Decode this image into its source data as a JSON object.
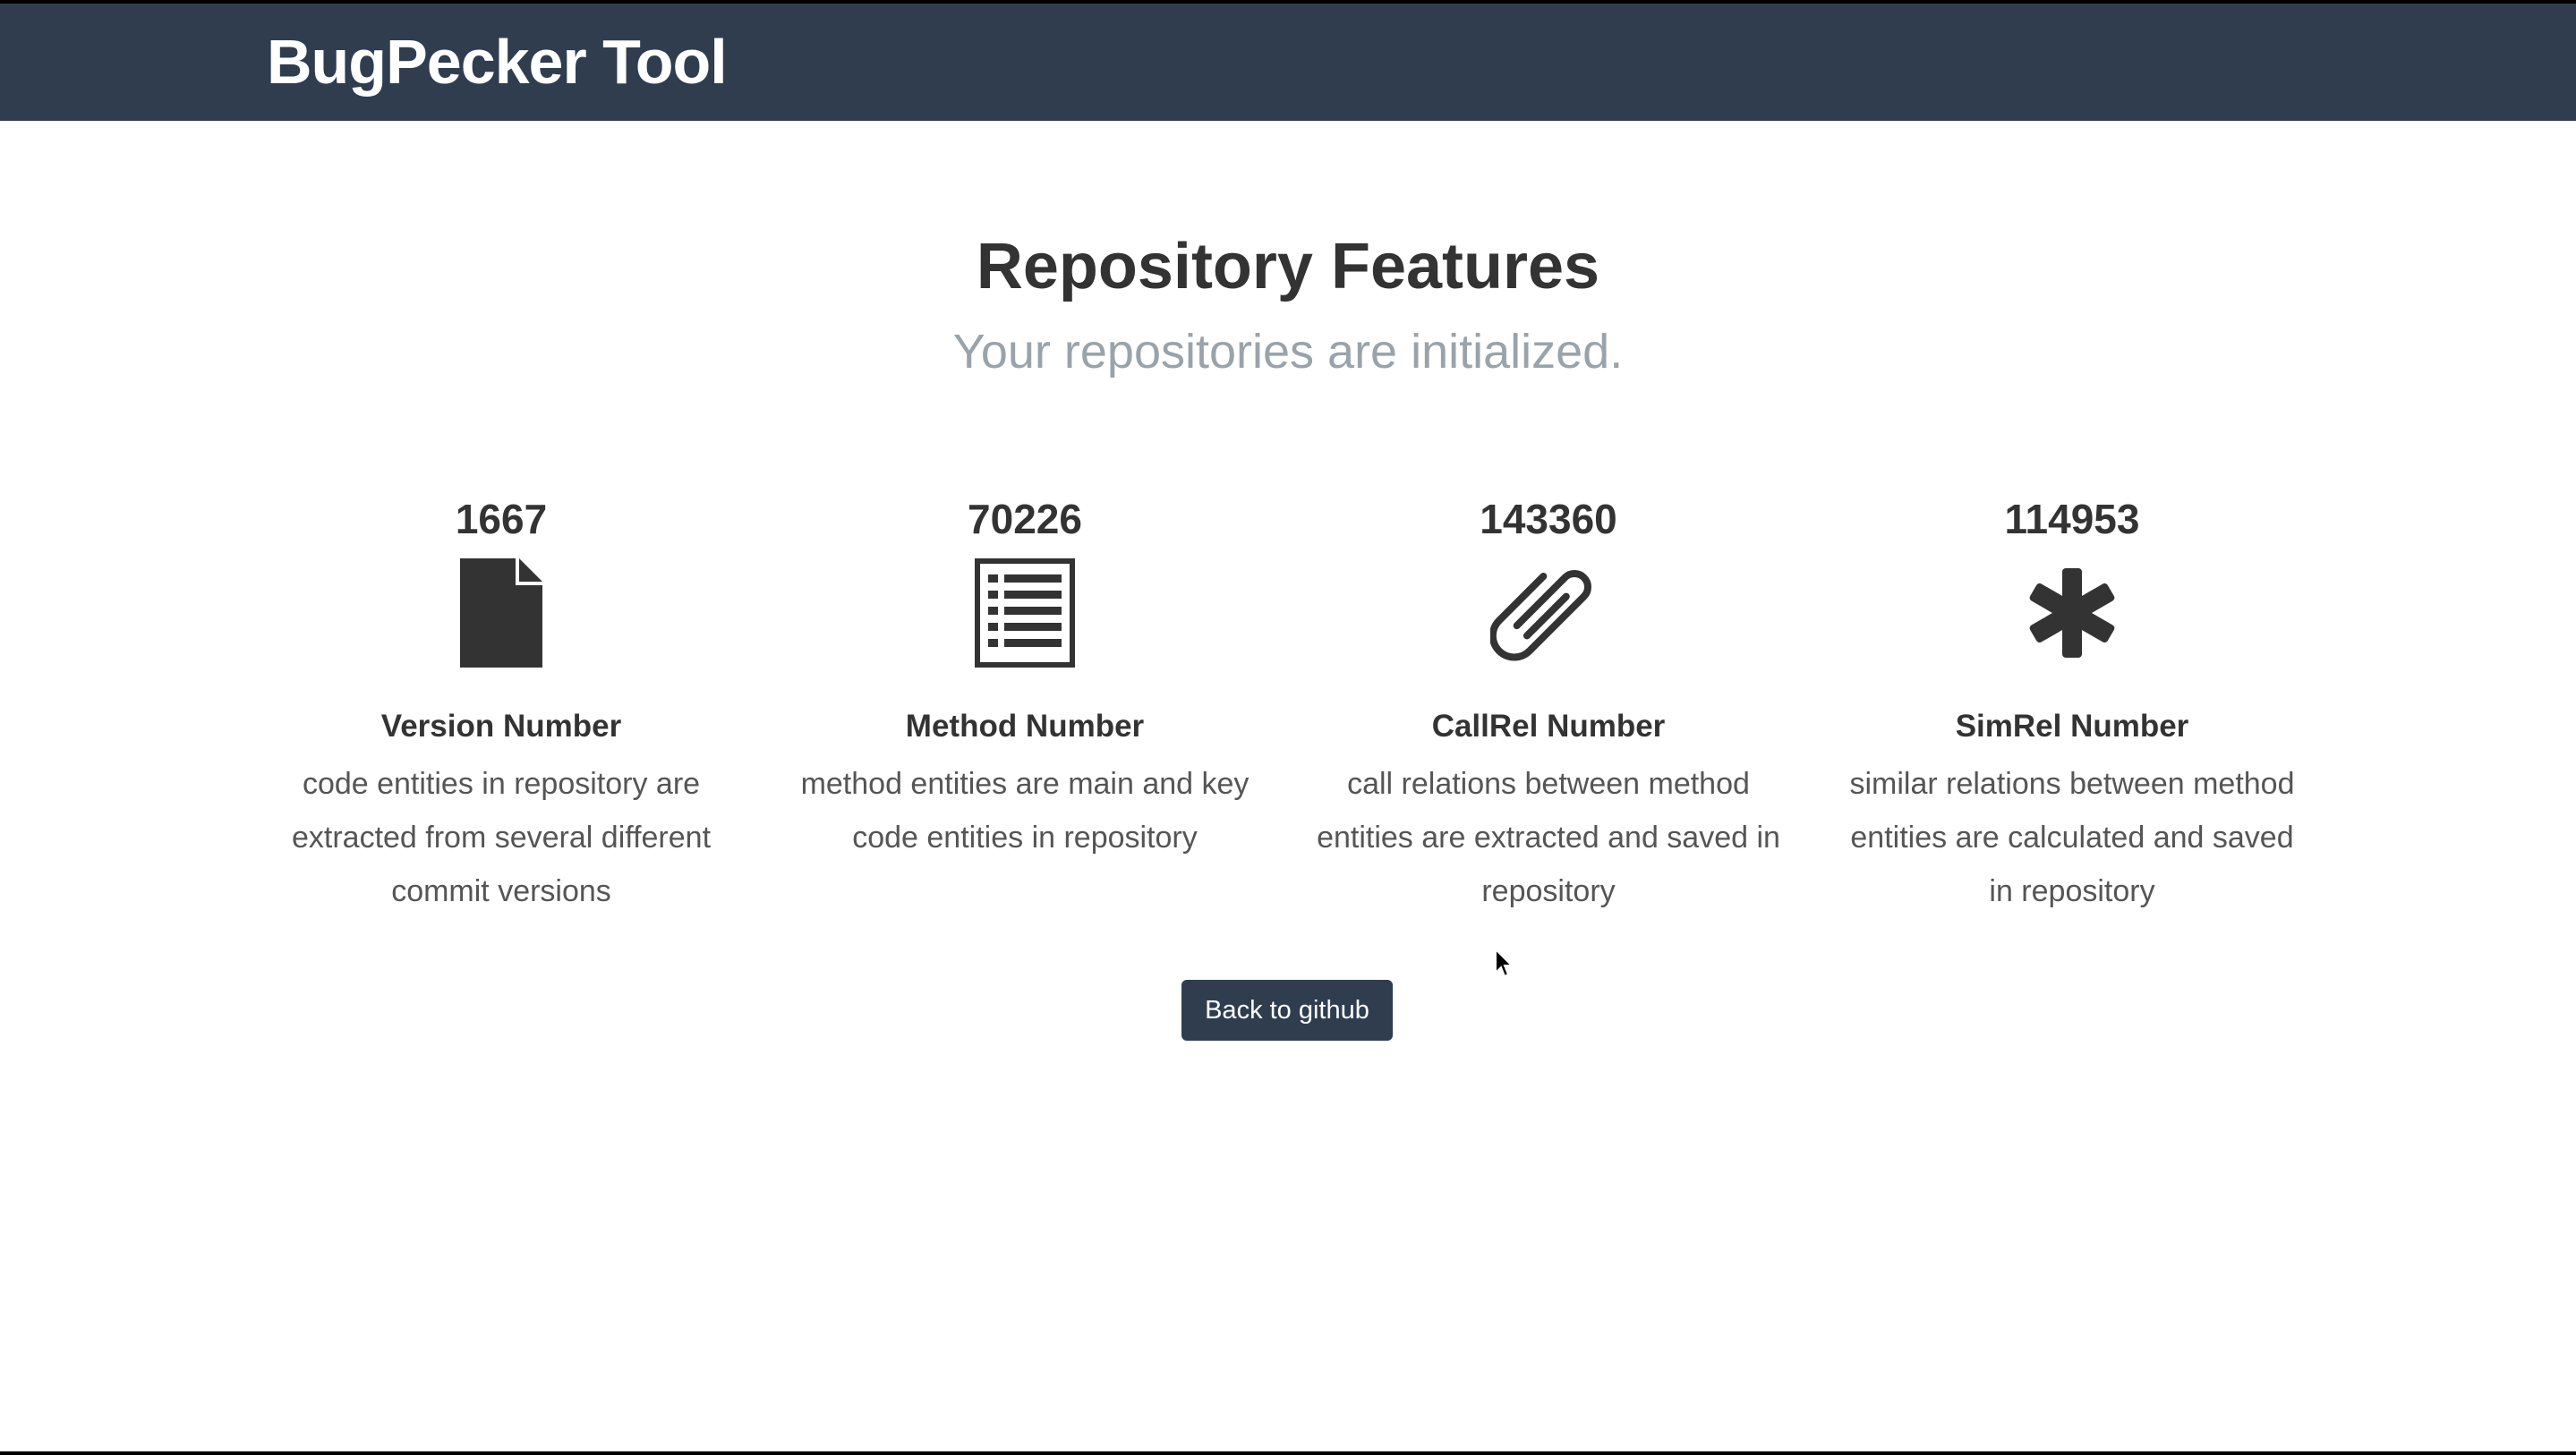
{
  "navbar": {
    "brand": "BugPecker Tool"
  },
  "main": {
    "heading": "Repository Features",
    "subheading": "Your repositories are initialized."
  },
  "features": [
    {
      "count": "1667",
      "icon": "file-icon",
      "title": "Version Number",
      "description": "code entities in repository are extracted from several different commit versions"
    },
    {
      "count": "70226",
      "icon": "list-icon",
      "title": "Method Number",
      "description": "method entities are main and key code entities in repository"
    },
    {
      "count": "143360",
      "icon": "paperclip-icon",
      "title": "CallRel Number",
      "description": "call relations between method entities are extracted and saved in repository"
    },
    {
      "count": "114953",
      "icon": "asterisk-icon",
      "title": "SimRel Number",
      "description": "similar relations between method entities are calculated and saved in repository"
    }
  ],
  "actions": {
    "back_label": "Back to github"
  },
  "colors": {
    "navbar": "#2f3d4f",
    "text": "#333333",
    "muted": "#9aa3aa"
  }
}
